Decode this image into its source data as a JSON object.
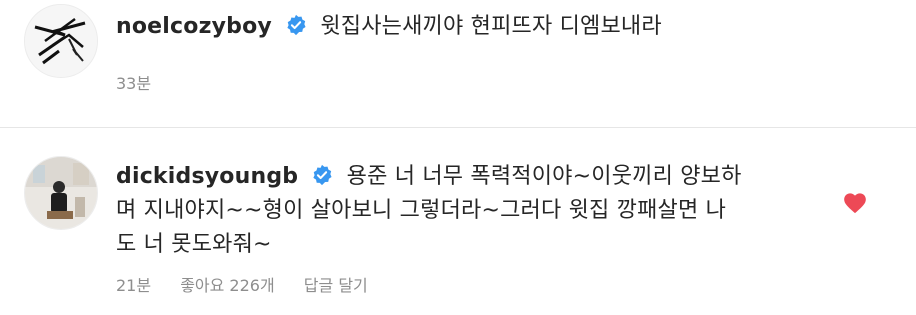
{
  "comments": [
    {
      "username": "noelcozyboy",
      "text": "윗집사는새끼야 현피뜨자 디엠보내라",
      "time": "33분"
    },
    {
      "username": "dickidsyoungb",
      "text_lines": [
        "용준 너 너무 폭력적이야~이웃끼리 양보하",
        "며 지내야지~~형이 살아보니 그렇더라~그러다 윗집 깡패살면 나",
        "도 너 못도와줘~"
      ],
      "time": "21분",
      "likes": "좋아요 226개",
      "reply_label": "답글 달기"
    }
  ],
  "icons": {
    "verified": "verified-badge-icon",
    "heart": "heart-icon"
  },
  "colors": {
    "verified": "#3897f0",
    "heart": "#ed4956",
    "meta": "#8e8e8e",
    "text": "#262626"
  }
}
